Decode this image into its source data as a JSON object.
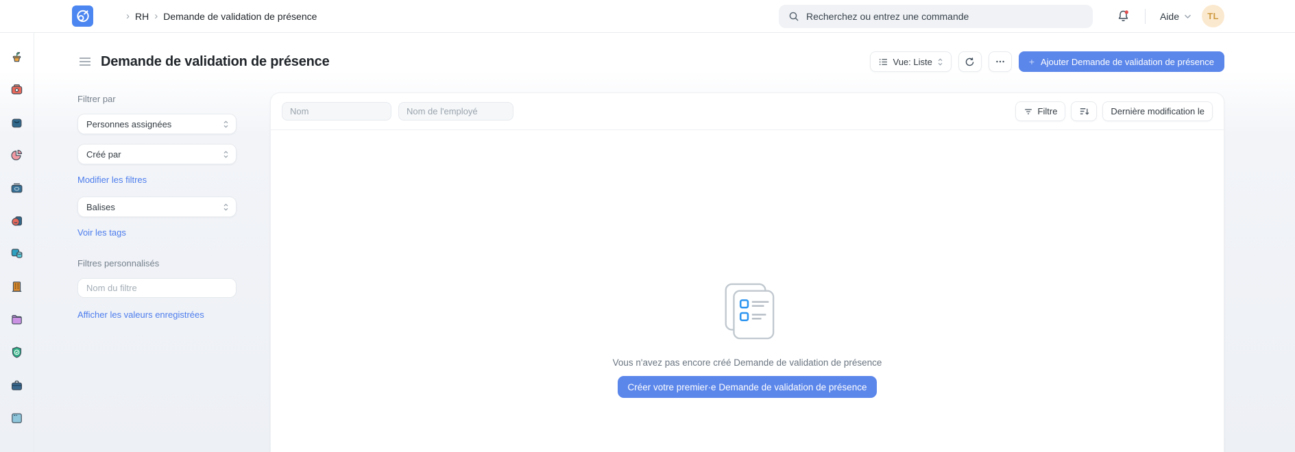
{
  "navbar": {
    "breadcrumb": [
      "RH",
      "Demande de validation de présence"
    ],
    "search_placeholder": "Recherchez ou entrez une commande",
    "help_label": "Aide",
    "avatar_initials": "TL"
  },
  "page": {
    "title": "Demande de validation de présence",
    "view_button_label": "Vue: Liste",
    "add_button_plus": "+",
    "add_button_label": "Ajouter Demande de validation de présence"
  },
  "filter_sidebar": {
    "filter_by_label": "Filtrer par",
    "assigned_select": "Personnes assignées",
    "created_by_select": "Créé par",
    "edit_filters_link": "Modifier les filtres",
    "tags_select": "Balises",
    "view_tags_link": "Voir les tags",
    "custom_filters_label": "Filtres personnalisés",
    "filter_name_placeholder": "Nom du filtre",
    "show_saved_values_link": "Afficher les valeurs enregistrées"
  },
  "list_toolbar": {
    "name_placeholder": "Nom",
    "employee_name_placeholder": "Nom de l'employé",
    "filter_button_label": "Filtre",
    "sort_button_label": "Dernière modification le"
  },
  "empty_state": {
    "message": "Vous n'avez pas encore créé Demande de validation de présence",
    "cta_label": "Créer votre premier·e Demande de validation de présence"
  },
  "workspace_icons": [
    "plant",
    "camera",
    "shopping-bag",
    "pie-chart",
    "cash",
    "mask",
    "data",
    "building",
    "folder",
    "shield-check",
    "briefcase",
    "board"
  ],
  "colors": {
    "primary": "#5B86EA",
    "link": "#4D7DEE",
    "logo_bg": "#4C86F0",
    "avatar_bg": "#FBE9CF",
    "avatar_text": "#CE9B42",
    "notification_dot": "#E24C4C",
    "empty_icon_accent": "#2D95F0"
  }
}
